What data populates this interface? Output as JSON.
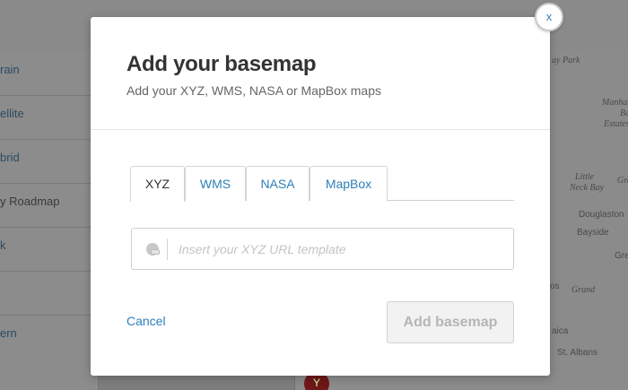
{
  "background": {
    "sidebar_items": [
      {
        "label": "rain",
        "style": "link"
      },
      {
        "label": "ellite",
        "style": "link"
      },
      {
        "label": "brid",
        "style": "link"
      },
      {
        "label": "y Roadmap",
        "style": "plain"
      },
      {
        "label": "k",
        "style": "link"
      },
      {
        "label": "",
        "style": "link"
      },
      {
        "label": "ern",
        "style": "link"
      }
    ],
    "map_labels": [
      "ay Park",
      "Manhasset",
      "Bay",
      "Estates",
      "Little",
      "Neck Bay",
      "Great",
      "Douglaston",
      "Bayside",
      "Grea",
      "os",
      "Grand",
      "aica",
      "St. Albans"
    ],
    "marker_icon": "Y"
  },
  "modal": {
    "title": "Add your basemap",
    "subtitle": "Add your XYZ, WMS, NASA or MapBox maps",
    "close_label": "x",
    "tabs": [
      {
        "label": "XYZ",
        "active": true
      },
      {
        "label": "WMS",
        "active": false
      },
      {
        "label": "NASA",
        "active": false
      },
      {
        "label": "MapBox",
        "active": false
      }
    ],
    "url_input": {
      "placeholder": "Insert your XYZ URL template",
      "value": "",
      "icon": "link-globe-icon"
    },
    "cancel_label": "Cancel",
    "submit_label": "Add basemap"
  },
  "colors": {
    "link": "#2d7fb8",
    "title": "#333333",
    "overlay": "#7d7d7d",
    "disabled_button_bg": "#f2f2f2",
    "disabled_button_text": "#b5b5b5"
  }
}
